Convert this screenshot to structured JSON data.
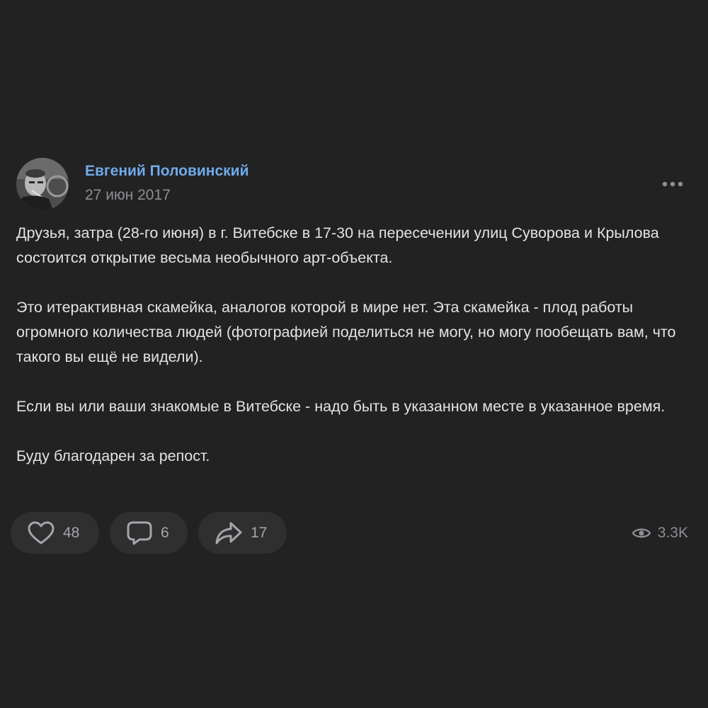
{
  "post": {
    "author": {
      "name": "Евгений Половинский",
      "avatar_icon": "user-photo-avatar"
    },
    "date": "27 июн 2017",
    "more_icon": "more-horizontal-icon",
    "paragraphs": [
      "Друзья, затра (28-го июня) в г. Витебске в 17-30 на пересечении улиц Суворова и Крылова состоится открытие весьма необычного арт-объекта.",
      "Это итерактивная скамейка, аналогов которой в мире нет. Эта скамейка - плод работы огромного количества людей (фотографией поделиться не могу, но могу пообещать вам, что такого вы ещё не видели).",
      "Если вы или ваши знакомые в Витебске - надо быть в указанном месте в указанное время.",
      "Буду благодарен за репост."
    ],
    "actions": {
      "likes": "48",
      "comments": "6",
      "shares": "17",
      "views": "3.3K"
    },
    "colors": {
      "background": "#222222",
      "author_link": "#71aaeb",
      "text": "#e1e3e6",
      "secondary": "#8c8f94",
      "button_bg": "#2f2f2f"
    }
  }
}
